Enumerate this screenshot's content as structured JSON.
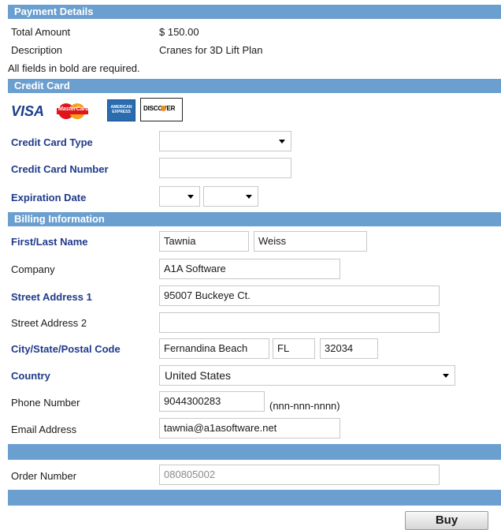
{
  "sections": {
    "payment": "Payment Details",
    "credit_card": "Credit Card",
    "billing": "Billing Information"
  },
  "payment": {
    "total_label": "Total Amount",
    "total_value": "$ 150.00",
    "description_label": "Description",
    "description_value": "Cranes for 3D Lift Plan",
    "required_note": "All fields in bold are required."
  },
  "cards": {
    "visa": "VISA",
    "mastercard": "MasterCard",
    "amex": "AMERICAN EXPRESS",
    "discover": "DISCOVER"
  },
  "credit_card": {
    "type_label": "Credit Card Type",
    "type_value": "",
    "number_label": "Credit Card Number",
    "number_value": "",
    "expiration_label": "Expiration Date",
    "exp_month": "",
    "exp_year": ""
  },
  "billing": {
    "name_label": "First/Last Name",
    "first_name": "Tawnia",
    "last_name": "Weiss",
    "company_label": "Company",
    "company": "A1A Software",
    "street1_label": "Street Address 1",
    "street1": "95007 Buckeye Ct.",
    "street2_label": "Street Address 2",
    "street2": "",
    "city_label": "City/State/Postal Code",
    "city": "Fernandina Beach",
    "state": "FL",
    "postal": "32034",
    "country_label": "Country",
    "country": "United States",
    "phone_label": "Phone Number",
    "phone": "9044300283",
    "phone_hint": "(nnn-nnn-nnnn)",
    "email_label": "Email Address",
    "email": "tawnia@a1asoftware.net"
  },
  "order": {
    "label": "Order Number",
    "value": "080805002"
  },
  "buy_label": "Buy",
  "colors": {
    "section_bar": "#6a9fd0",
    "required_label": "#1f3a8a",
    "visa_blue": "#1a3c8c",
    "mastercard_red": "#e0151b",
    "amex_blue": "#2b6cb0",
    "discover_orange": "#f08a1c"
  }
}
